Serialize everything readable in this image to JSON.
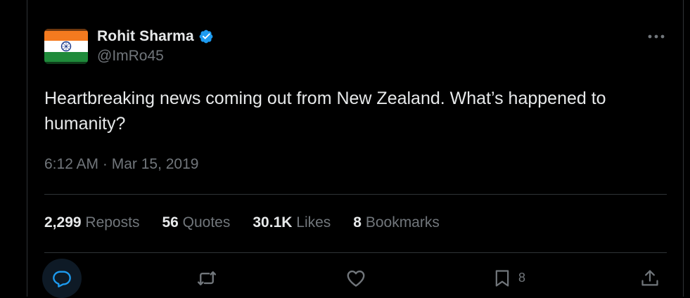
{
  "author": {
    "display_name": "Rohit Sharma",
    "handle": "@ImRo45",
    "verified": true,
    "avatar": "india-flag-avatar"
  },
  "tweet": {
    "text": "Heartbreaking news coming out from New Zealand. What’s happened to humanity?",
    "timestamp": "6:12 AM · Mar 15, 2019"
  },
  "stats": [
    {
      "value": "2,299",
      "label": "Reposts"
    },
    {
      "value": "56",
      "label": "Quotes"
    },
    {
      "value": "30.1K",
      "label": "Likes"
    },
    {
      "value": "8",
      "label": "Bookmarks"
    }
  ],
  "actions": {
    "reply_icon": "reply-icon",
    "repost_icon": "repost-icon",
    "like_icon": "heart-icon",
    "bookmark_icon": "bookmark-icon",
    "bookmark_count": "8",
    "share_icon": "share-icon"
  },
  "colors": {
    "background": "#000000",
    "text": "#e7e9ea",
    "secondary_text": "#71767b",
    "accent": "#1d9bf0",
    "divider": "#2f3336"
  }
}
